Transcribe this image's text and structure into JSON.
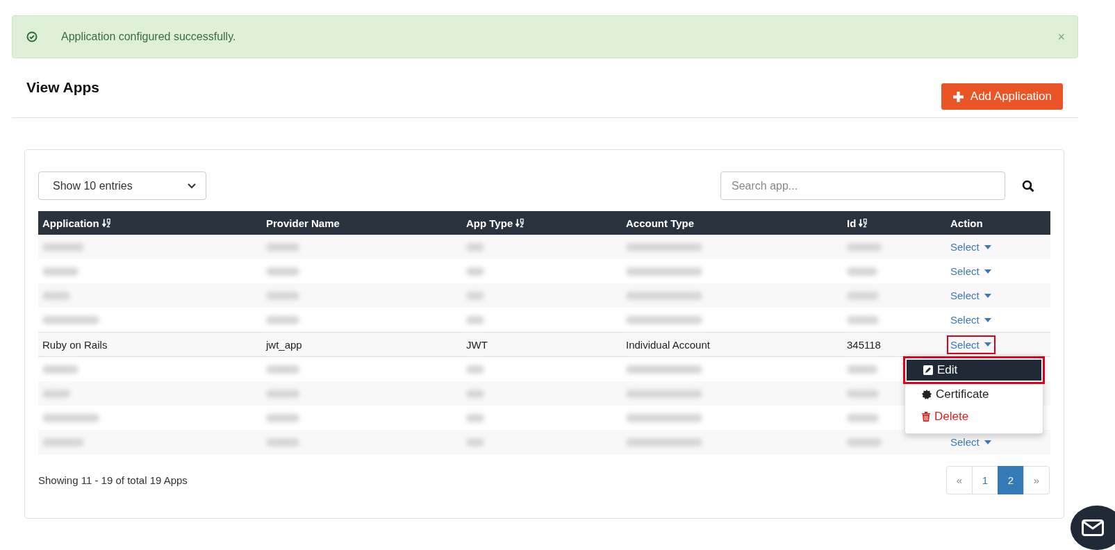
{
  "alert": {
    "message": "Application configured successfully.",
    "close": "×"
  },
  "header": {
    "title": "View Apps",
    "add_button": "Add Application"
  },
  "length_select": {
    "value": "Show 10 entries"
  },
  "search": {
    "placeholder": "Search app..."
  },
  "table": {
    "columns": [
      {
        "label": "Application",
        "sortable": true
      },
      {
        "label": "Provider Name",
        "sortable": false
      },
      {
        "label": "App Type",
        "sortable": true
      },
      {
        "label": "Account Type",
        "sortable": false
      },
      {
        "label": "Id",
        "sortable": true
      },
      {
        "label": "Action",
        "sortable": false
      }
    ],
    "rows": [
      {
        "redacted": true,
        "action": "Select",
        "highlighted": false,
        "menu_open": false
      },
      {
        "redacted": true,
        "action": "Select",
        "highlighted": false,
        "menu_open": false
      },
      {
        "redacted": true,
        "action": "Select",
        "highlighted": false,
        "menu_open": false
      },
      {
        "redacted": true,
        "action": "Select",
        "highlighted": false,
        "menu_open": false
      },
      {
        "redacted": false,
        "cells": [
          "Ruby on Rails",
          "jwt_app",
          "JWT",
          "Individual Account",
          "345118"
        ],
        "action": "Select",
        "highlighted": true,
        "menu_open": true
      },
      {
        "redacted": true,
        "menu_open": false
      },
      {
        "redacted": true,
        "menu_open": false
      },
      {
        "redacted": true,
        "menu_open": false
      },
      {
        "redacted": true,
        "action": "Select",
        "highlighted": false,
        "menu_open": false
      }
    ]
  },
  "action_menu": [
    {
      "kind": "edit",
      "label": "Edit",
      "selected": true
    },
    {
      "kind": "certificate",
      "label": "Certificate",
      "selected": false
    },
    {
      "kind": "delete",
      "label": "Delete",
      "selected": false
    }
  ],
  "footer": {
    "summary": "Showing 11 - 19 of total 19 Apps"
  },
  "pagination": [
    {
      "label": "«",
      "selected": false
    },
    {
      "label": "1",
      "selected": false
    },
    {
      "label": "2",
      "selected": true
    },
    {
      "label": "»",
      "selected": false
    }
  ]
}
